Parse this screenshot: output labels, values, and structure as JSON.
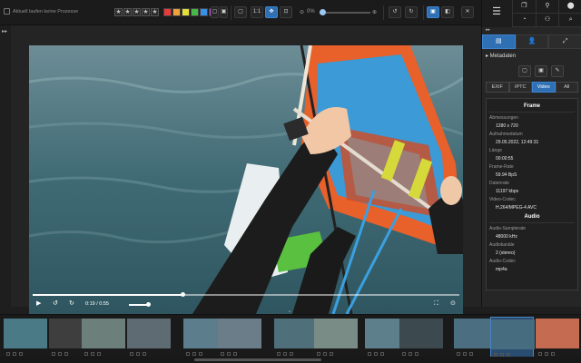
{
  "toolbar": {
    "status_text": "Aktuell laufen keine Prozesse",
    "star_glyph": "★",
    "color_labels": [
      "#e53b3b",
      "#f0a23a",
      "#e6de3a",
      "#47b847",
      "#3a8fe6",
      "#b24fd1"
    ],
    "tool_a": "▢",
    "tool_b": "▣",
    "fit_label": "▢",
    "one_to_one_label": "1:1",
    "move_label": "✥",
    "fill_label": "⊡",
    "zoom_out_label": "⊖",
    "zoom_pct_label": "0%",
    "zoom_in_label": "⊕",
    "zoom_fraction": 0.05,
    "rotate_left_label": "↺",
    "rotate_right_label": "↻",
    "single_view_label": "▣",
    "compare_view_label": "◧",
    "close_label": "✕"
  },
  "left_edge": {
    "arrow": "▸▸"
  },
  "video": {
    "play_icon": "▶",
    "rewind_icon": "↺",
    "forward_icon": "↻",
    "time_display": "0:19 / 0:55",
    "progress_fraction": 0.35,
    "fullscreen_icon": "⛶",
    "speed_icon": "⊙"
  },
  "right_panel": {
    "main_icon": "☰",
    "grid_icons": [
      "❐",
      "⬤",
      "⚲",
      "◔",
      "⚇",
      "⌕"
    ],
    "collapse_arrow": "▸▸",
    "tabs": [
      "▤",
      "👤",
      "⤢"
    ],
    "section_title": "▸ Metadaten",
    "action_icons": [
      "▢",
      "▣",
      "✎"
    ],
    "metadata_tabs": [
      "EXIF",
      "IPTC",
      "Video",
      "All"
    ],
    "frame_heading": "Frame",
    "audio_heading": "Audio",
    "frame_fields": [
      {
        "label": "Abmessungen",
        "value": "1280 x 720"
      },
      {
        "label": "Aufnahmedatum",
        "value": "29.05.2022, 12:49:31"
      },
      {
        "label": "Länge",
        "value": "00:00:55"
      },
      {
        "label": "Frame-Rate",
        "value": "59.94 BpS"
      },
      {
        "label": "Datenrate",
        "value": "11197 kbps"
      },
      {
        "label": "Video-Codec",
        "value": "H.264/MPEG-4 AVC"
      }
    ],
    "audio_fields": [
      {
        "label": "Audio-Samplerate",
        "value": "48000 kHz"
      },
      {
        "label": "Audiokanäle",
        "value": "2 (stereo)"
      },
      {
        "label": "Audio-Codec",
        "value": "mp4a"
      }
    ]
  },
  "filmstrip": {
    "handle_icon": "⌄",
    "thumbs": [
      {
        "tone": "#4a7a86"
      },
      {
        "tone": "#3e3e3e"
      },
      {
        "tone": "#6c7f7b"
      },
      {
        "tone": "#5e6b73"
      },
      {
        "tone": "#5b7d8c"
      },
      {
        "tone": "#6a7d88"
      },
      {
        "tone": "#4f6f7a"
      },
      {
        "tone": "#7a8c86"
      },
      {
        "tone": "#5d7e8b"
      },
      {
        "tone": "#3c4a50"
      },
      {
        "tone": "#4b6f80"
      },
      {
        "tone": "#466c80"
      },
      {
        "tone": "#c56b51"
      }
    ],
    "selected_index": 11
  }
}
